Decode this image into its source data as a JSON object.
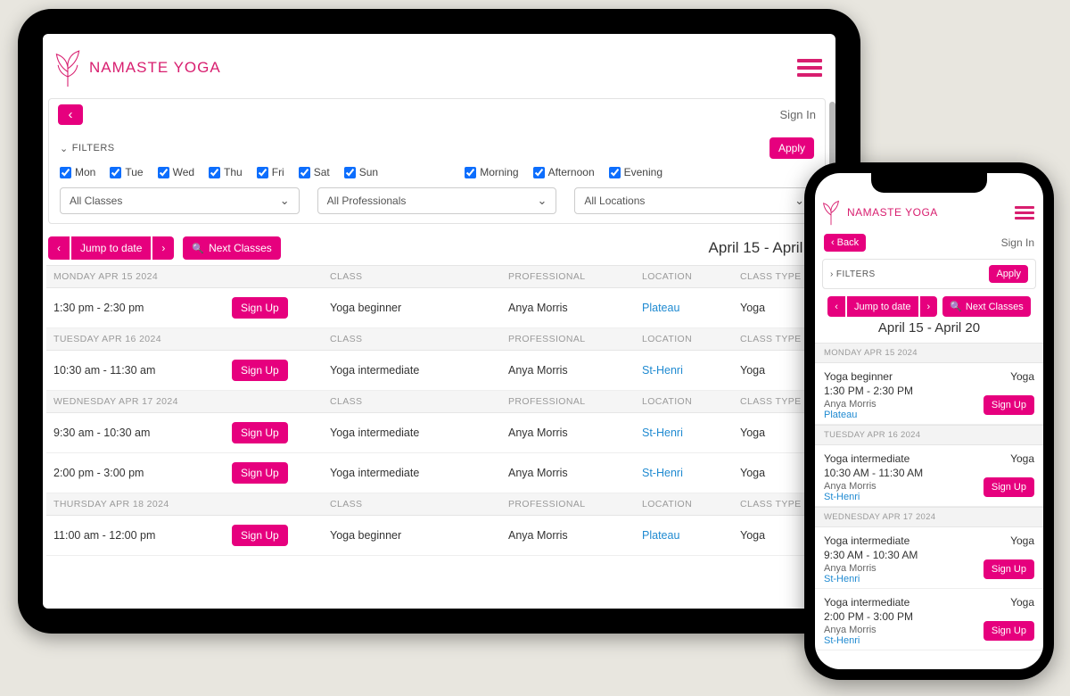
{
  "brand": {
    "name": "NAMASTE YOGA"
  },
  "auth": {
    "sign_in": "Sign In",
    "back": "Back"
  },
  "filters": {
    "title": "FILTERS",
    "apply": "Apply",
    "days": {
      "mon": "Mon",
      "tue": "Tue",
      "wed": "Wed",
      "thu": "Thu",
      "fri": "Fri",
      "sat": "Sat",
      "sun": "Sun"
    },
    "times": {
      "morning": "Morning",
      "afternoon": "Afternoon",
      "evening": "Evening"
    },
    "selects": {
      "classes": "All Classes",
      "professionals": "All Professionals",
      "locations": "All Locations"
    }
  },
  "controls": {
    "jump_to_date": "Jump to date",
    "next_classes": "Next Classes",
    "sign_up": "Sign Up"
  },
  "date_range": "April 15 - April 20",
  "columns": {
    "class": "CLASS",
    "professional": "PROFESSIONAL",
    "location": "LOCATION",
    "class_type": "CLASS TYPE"
  },
  "tablet_days": [
    {
      "header": "MONDAY APR 15 2024",
      "classes": [
        {
          "time": "1:30 pm - 2:30 pm",
          "class": "Yoga beginner",
          "prof": "Anya Morris",
          "loc": "Plateau",
          "type": "Yoga"
        }
      ]
    },
    {
      "header": "TUESDAY APR 16 2024",
      "classes": [
        {
          "time": "10:30 am - 11:30 am",
          "class": "Yoga intermediate",
          "prof": "Anya Morris",
          "loc": "St-Henri",
          "type": "Yoga"
        }
      ]
    },
    {
      "header": "WEDNESDAY APR 17 2024",
      "classes": [
        {
          "time": "9:30 am - 10:30 am",
          "class": "Yoga intermediate",
          "prof": "Anya Morris",
          "loc": "St-Henri",
          "type": "Yoga"
        },
        {
          "time": "2:00 pm - 3:00 pm",
          "class": "Yoga intermediate",
          "prof": "Anya Morris",
          "loc": "St-Henri",
          "type": "Yoga"
        }
      ]
    },
    {
      "header": "THURSDAY APR 18 2024",
      "classes": [
        {
          "time": "11:00 am - 12:00 pm",
          "class": "Yoga beginner",
          "prof": "Anya Morris",
          "loc": "Plateau",
          "type": "Yoga"
        }
      ]
    }
  ],
  "phone_days": [
    {
      "header": "MONDAY APR 15 2024",
      "classes": [
        {
          "name": "Yoga beginner",
          "type": "Yoga",
          "time": "1:30 PM - 2:30 PM",
          "prof": "Anya Morris",
          "loc": "Plateau"
        }
      ]
    },
    {
      "header": "TUESDAY APR 16 2024",
      "classes": [
        {
          "name": "Yoga intermediate",
          "type": "Yoga",
          "time": "10:30 AM - 11:30 AM",
          "prof": "Anya Morris",
          "loc": "St-Henri"
        }
      ]
    },
    {
      "header": "WEDNESDAY APR 17 2024",
      "classes": [
        {
          "name": "Yoga intermediate",
          "type": "Yoga",
          "time": "9:30 AM - 10:30 AM",
          "prof": "Anya Morris",
          "loc": "St-Henri"
        },
        {
          "name": "Yoga intermediate",
          "type": "Yoga",
          "time": "2:00 PM - 3:00 PM",
          "prof": "Anya Morris",
          "loc": "St-Henri"
        }
      ]
    }
  ]
}
